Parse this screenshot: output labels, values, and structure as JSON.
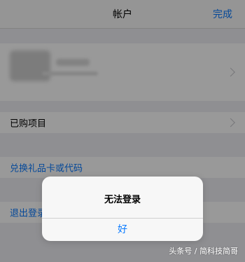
{
  "navbar": {
    "title": "帐户",
    "done_label": "完成"
  },
  "rows": {
    "purchased_label": "已购项目",
    "redeem_label": "兑换礼品卡或代码",
    "signout_label": "退出登录"
  },
  "alert": {
    "title": "无法登录",
    "ok_label": "好"
  },
  "watermark": {
    "text": "头条号 / 简科技简哥"
  },
  "colors": {
    "accent": "#0a7aff"
  }
}
